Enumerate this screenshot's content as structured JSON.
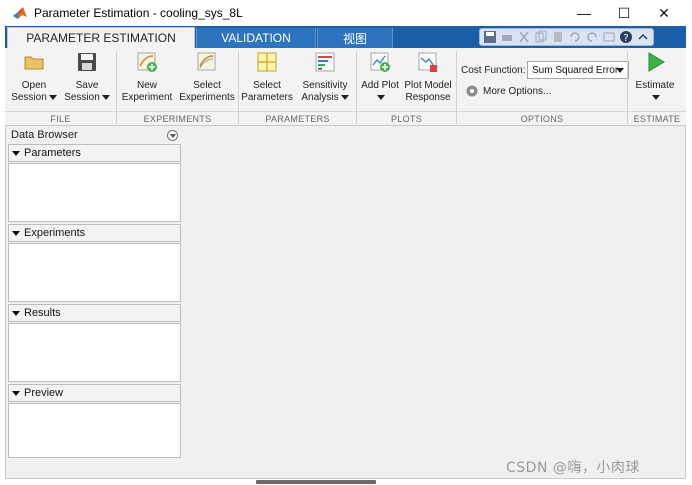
{
  "window": {
    "title": "Parameter Estimation - cooling_sys_8L",
    "minimize_glyph": "—",
    "maximize_glyph": "☐",
    "close_glyph": "✕"
  },
  "tabs": [
    {
      "label": "PARAMETER ESTIMATION",
      "active": true
    },
    {
      "label": "VALIDATION",
      "active": false
    },
    {
      "label": "视图",
      "active": false
    }
  ],
  "quick_access_icons": [
    "save-icon",
    "print-icon",
    "cut-icon",
    "copy-icon",
    "paste-icon",
    "undo-icon",
    "redo-icon",
    "switch-windows-icon",
    "help-icon",
    "collapse-ribbon-icon"
  ],
  "ribbon": {
    "file": {
      "section_label": "FILE",
      "open_session": "Open\nSession",
      "save_session": "Save\nSession"
    },
    "experiments": {
      "section_label": "EXPERIMENTS",
      "new_experiment": "New\nExperiment",
      "select_experiments": "Select\nExperiments"
    },
    "parameters": {
      "section_label": "PARAMETERS",
      "select_parameters": "Select\nParameters",
      "sensitivity_analysis": "Sensitivity\nAnalysis"
    },
    "plots": {
      "section_label": "PLOTS",
      "add_plot": "Add Plot",
      "plot_model_response": "Plot Model\nResponse"
    },
    "options": {
      "section_label": "OPTIONS",
      "cost_function_label": "Cost Function:",
      "cost_function_value": "Sum Squared Error",
      "more_options": "More Options..."
    },
    "estimate": {
      "section_label": "ESTIMATE",
      "estimate": "Estimate"
    }
  },
  "data_browser": {
    "title": "Data Browser",
    "panels": [
      {
        "label": "Parameters"
      },
      {
        "label": "Experiments"
      },
      {
        "label": "Results"
      },
      {
        "label": "Preview"
      }
    ]
  },
  "watermark": "CSDN @嗨，小肉球",
  "colors": {
    "tab_strip": "#1b5fa8",
    "ribbon_bg": "#f3f3f3",
    "workspace_bg": "#f0f0f0",
    "estimate_green": "#3cb043"
  }
}
